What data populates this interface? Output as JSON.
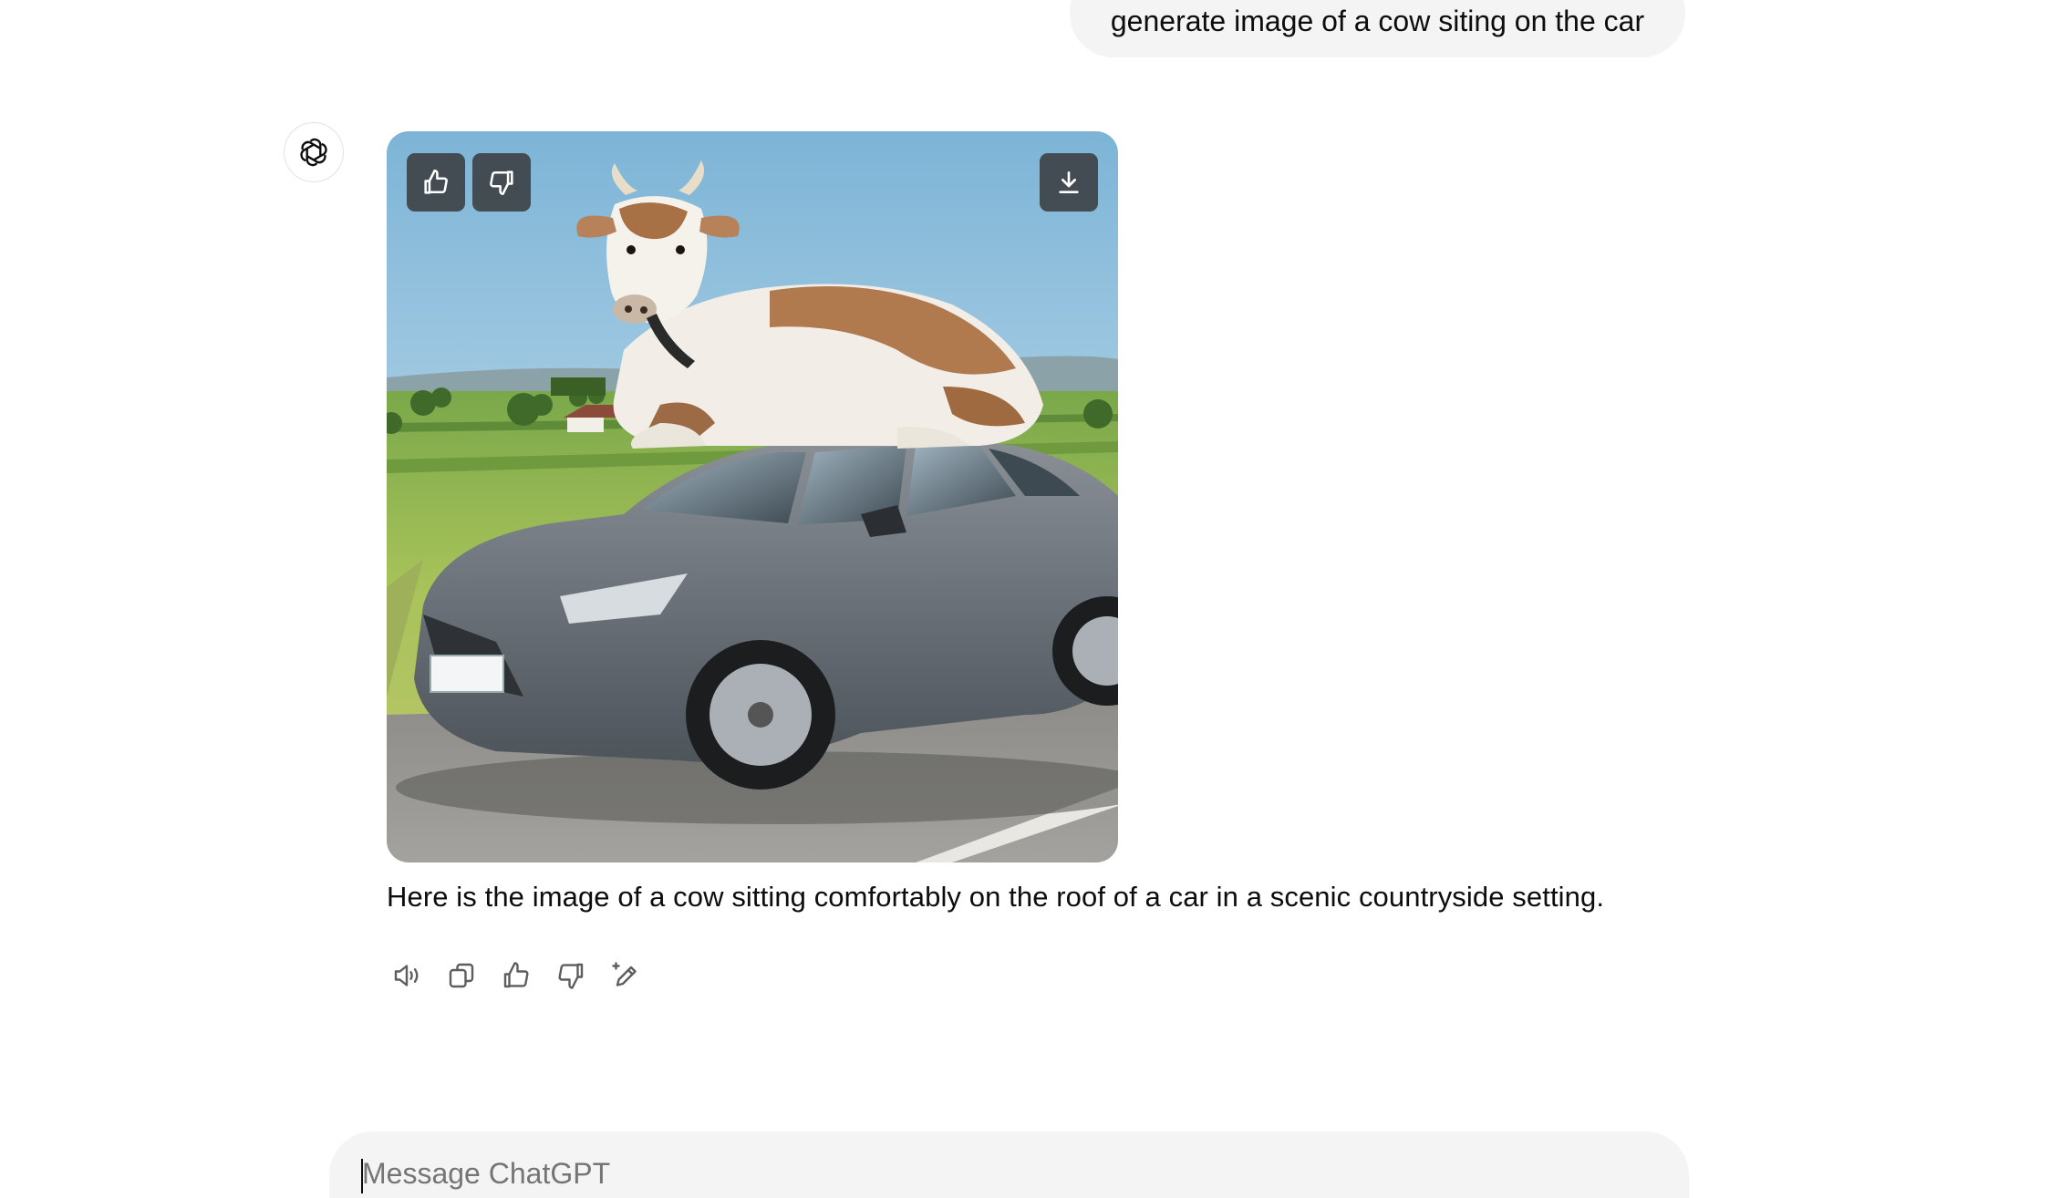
{
  "conversation": {
    "user_message": "generate image of a cow siting on the car",
    "assistant_message": "Here is the image of a cow sitting comfortably on the roof of a car in a scenic countryside setting."
  },
  "image_overlay": {
    "like_icon": "thumbs-up-icon",
    "dislike_icon": "thumbs-down-icon",
    "download_icon": "download-icon"
  },
  "message_actions": [
    {
      "name": "read-aloud",
      "icon": "speaker-icon"
    },
    {
      "name": "copy",
      "icon": "copy-icon"
    },
    {
      "name": "good-response",
      "icon": "thumbs-up-icon"
    },
    {
      "name": "bad-response",
      "icon": "thumbs-down-icon"
    },
    {
      "name": "change-model",
      "icon": "sparkle-pen-icon"
    }
  ],
  "composer": {
    "placeholder": "Message ChatGPT",
    "value": ""
  }
}
